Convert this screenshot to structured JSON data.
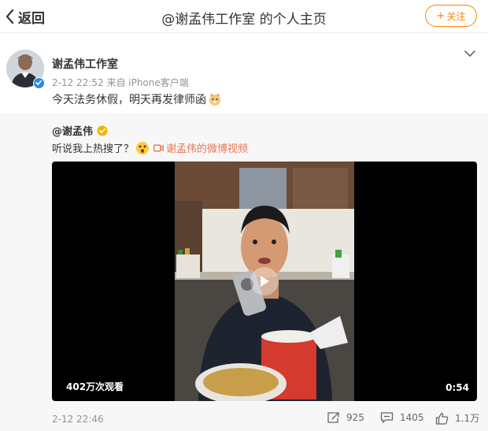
{
  "header": {
    "back_label": "返回",
    "title": "@谢孟伟工作室 的个人主页",
    "follow_label": "关注"
  },
  "post": {
    "author": "谢孟伟工作室",
    "meta": "2-12 22:52  来自 iPhone客户端",
    "text": "今天法务休假，明天再发律师函"
  },
  "repost": {
    "author": "@谢孟伟",
    "text": "听说我上热搜了？",
    "link_label": "谢孟伟的微博视频",
    "video": {
      "views": "402万次观看",
      "duration": "0:54"
    },
    "time": "2-12 22:46",
    "shares": "925",
    "comments": "1405",
    "likes": "1.1万"
  },
  "colors": {
    "accent": "#ff8200",
    "link": "#eb7350",
    "verified_blue": "#2c89e8",
    "repost_bg": "#f7f7f7"
  }
}
